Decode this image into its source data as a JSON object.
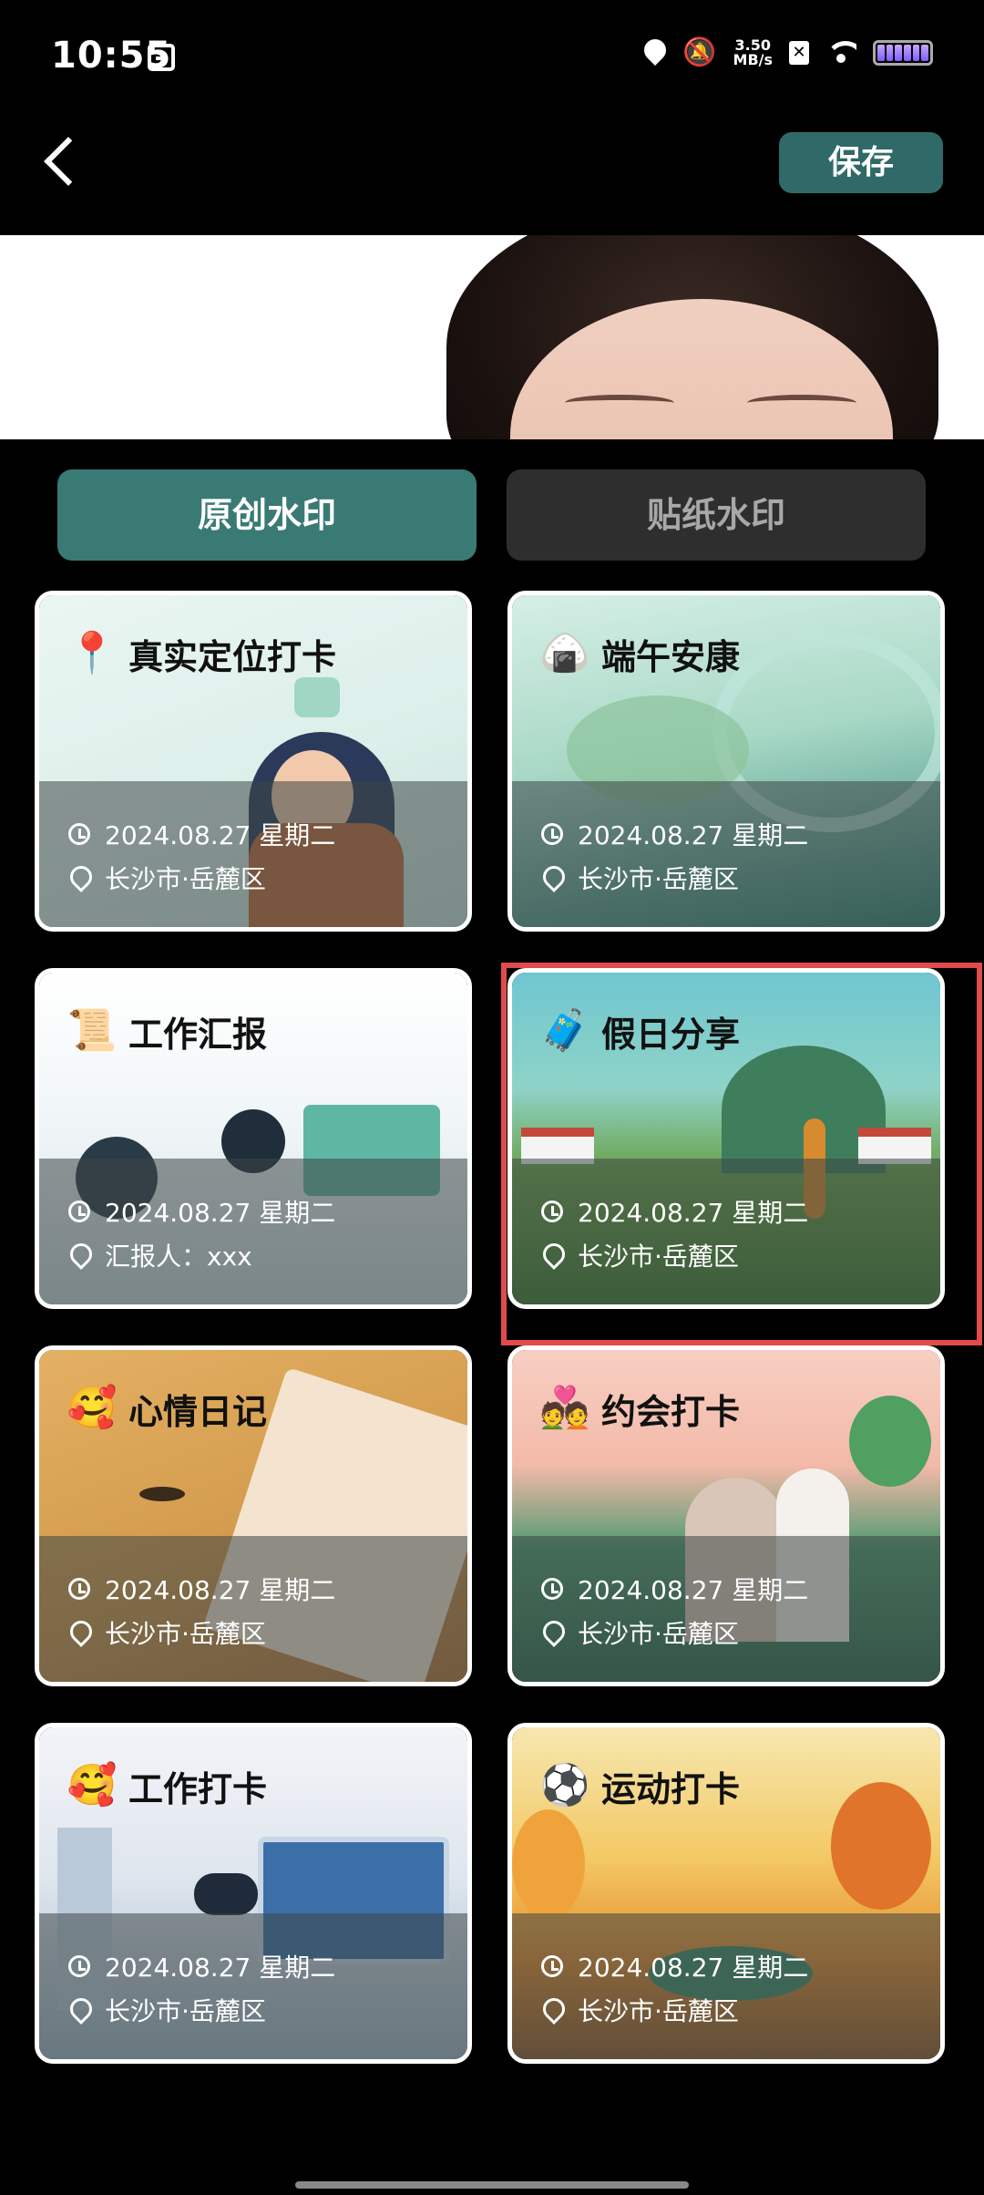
{
  "status_bar": {
    "time": "10:55",
    "network_speed_value": "3.50",
    "network_speed_unit": "MB/s",
    "icons": [
      "calendar-icon",
      "location-icon",
      "mute-icon",
      "x-app-icon",
      "wifi-icon",
      "battery-icon"
    ]
  },
  "header": {
    "save_label": "保存"
  },
  "tabs": [
    {
      "label": "原创水印",
      "active": true
    },
    {
      "label": "贴纸水印",
      "active": false
    }
  ],
  "templates": [
    {
      "title": "真实定位打卡",
      "icon": "location-pin-icon",
      "date": "2024.08.27 星期二",
      "location": "长沙市·岳麓区"
    },
    {
      "title": "端午安康",
      "icon": "zongzi-icon",
      "date": "2024.08.27 星期二",
      "location": "长沙市·岳麓区"
    },
    {
      "title": "工作汇报",
      "icon": "scroll-icon",
      "date": "2024.08.27 星期二",
      "location": "汇报人：xxx"
    },
    {
      "title": "假日分享",
      "icon": "travel-bag-icon",
      "date": "2024.08.27 星期二",
      "location": "长沙市·岳麓区",
      "selected": true
    },
    {
      "title": "心情日记",
      "icon": "smiley-hearts-icon",
      "date": "2024.08.27 星期二",
      "location": "长沙市·岳麓区"
    },
    {
      "title": "约会打卡",
      "icon": "couple-icon",
      "date": "2024.08.27 星期二",
      "location": "长沙市·岳麓区"
    },
    {
      "title": "工作打卡",
      "icon": "smiley-hearts-icon",
      "date": "2024.08.27 星期二",
      "location": "长沙市·岳麓区"
    },
    {
      "title": "运动打卡",
      "icon": "balls-icon",
      "date": "2024.08.27 星期二",
      "location": "长沙市·岳麓区"
    }
  ],
  "colors": {
    "accent": "#3a7a75",
    "save_button": "#2f6a68",
    "selection": "#e24b4b",
    "inactive_tab": "#2e2e2e"
  }
}
